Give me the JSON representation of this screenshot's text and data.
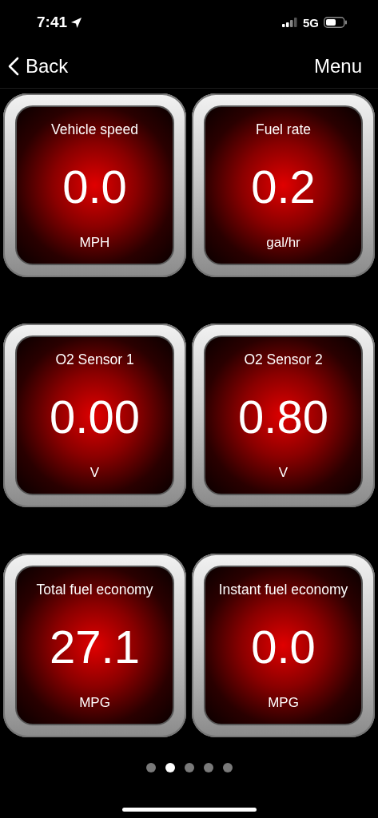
{
  "status_bar": {
    "time": "7:41",
    "network": "5G"
  },
  "nav": {
    "back": "Back",
    "menu": "Menu"
  },
  "gauges": [
    {
      "title": "Vehicle speed",
      "value": "0.0",
      "unit": "MPH"
    },
    {
      "title": "Fuel rate",
      "value": "0.2",
      "unit": "gal/hr"
    },
    {
      "title": "O2 Sensor 1",
      "value": "0.00",
      "unit": "V"
    },
    {
      "title": "O2 Sensor 2",
      "value": "0.80",
      "unit": "V"
    },
    {
      "title": "Total fuel economy",
      "value": "27.1",
      "unit": "MPG"
    },
    {
      "title": "Instant fuel economy",
      "value": "0.0",
      "unit": "MPG"
    }
  ],
  "pages": [
    {
      "selected": false
    },
    {
      "selected": true
    },
    {
      "selected": false
    },
    {
      "selected": false
    },
    {
      "selected": false
    }
  ]
}
